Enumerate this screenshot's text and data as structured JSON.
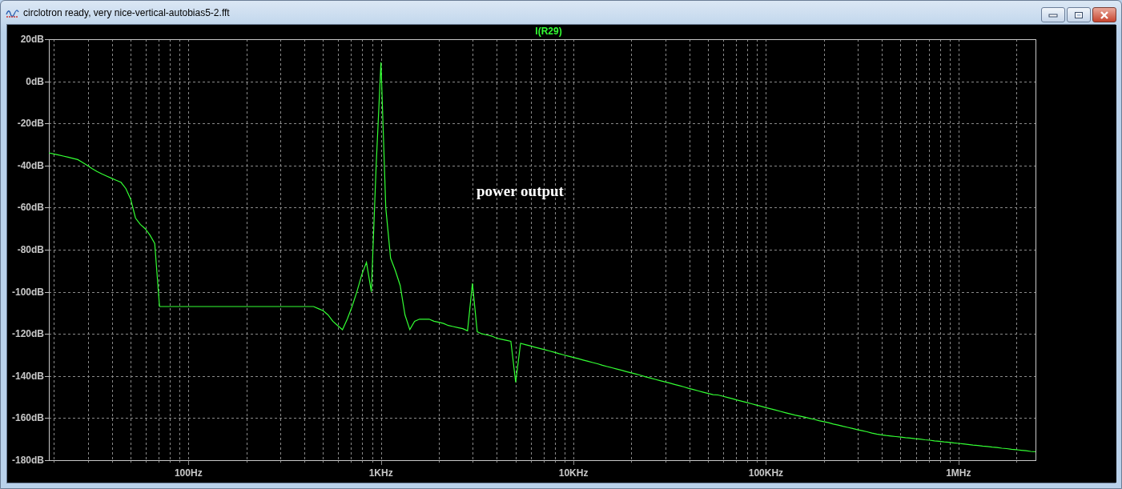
{
  "window": {
    "title": "circlotron ready, very nice-vertical-autobias5-2.fft"
  },
  "plot": {
    "chart_data": {
      "type": "line",
      "grid": true,
      "ylim": [
        -180,
        20
      ],
      "categories": [
        null,
        null,
        null,
        null,
        null,
        null,
        null,
        null,
        null,
        null,
        null,
        null,
        null,
        null,
        null,
        null,
        null,
        null,
        null,
        null,
        null,
        null,
        null,
        null,
        null,
        null,
        null,
        null,
        null,
        "100Hz",
        null,
        null,
        null,
        null,
        null,
        null,
        null,
        null,
        null,
        null,
        null,
        null,
        null,
        null,
        null,
        null,
        null,
        null,
        null,
        null,
        null,
        null,
        null,
        null,
        null,
        null,
        null,
        null,
        null,
        null,
        null,
        null,
        null,
        null,
        null,
        null,
        null,
        null,
        null,
        "1KHz",
        null,
        null,
        null,
        null,
        null,
        null,
        null,
        null,
        null,
        null,
        null,
        null,
        null,
        null,
        null,
        null,
        null,
        null,
        null,
        null,
        null,
        null,
        null,
        null,
        null,
        null,
        null,
        null,
        null,
        null,
        null,
        null,
        null,
        null,
        null,
        null,
        null,
        null,
        null,
        "10KHz",
        null,
        null,
        null,
        null,
        null,
        null,
        null,
        null,
        null,
        null,
        null,
        null,
        null,
        null,
        null,
        null,
        null,
        null,
        null,
        null,
        null,
        null,
        null,
        null,
        null,
        null,
        null,
        null,
        null,
        null,
        null,
        null,
        null,
        null,
        null,
        null,
        null,
        null,
        null,
        "100KHz",
        null,
        null,
        null,
        null,
        null,
        null,
        null,
        null,
        null,
        null,
        null,
        null,
        null,
        null,
        null,
        null,
        null,
        null,
        null,
        null,
        null,
        null,
        null,
        null,
        null,
        null,
        null,
        null,
        null,
        null,
        null,
        null,
        null,
        null,
        null,
        null,
        null,
        null,
        null,
        "1MHz",
        null,
        null,
        null,
        null,
        null,
        null,
        null,
        null,
        null,
        null,
        null,
        null,
        null,
        null,
        null,
        null
      ],
      "yticks": [
        {
          "value": 20,
          "label": "20dB"
        },
        {
          "value": 0,
          "label": "0dB"
        },
        {
          "value": -20,
          "label": "-20dB"
        },
        {
          "value": -40,
          "label": "-40dB"
        },
        {
          "value": -60,
          "label": "-60dB"
        },
        {
          "value": -80,
          "label": "-80dB"
        },
        {
          "value": -100,
          "label": "-100dB"
        },
        {
          "value": -120,
          "label": "-120dB"
        },
        {
          "value": -140,
          "label": "-140dB"
        },
        {
          "value": -160,
          "label": "-160dB"
        },
        {
          "value": -180,
          "label": "-180dB"
        }
      ],
      "series": [
        {
          "name": "I(R29)",
          "color": "#33ff33",
          "values": [
            -34,
            -34.5,
            -35,
            -35.5,
            -36,
            -36.6,
            -37.2,
            -38.5,
            -40,
            -41.5,
            -42.8,
            -44,
            -45,
            -46,
            -47,
            -48,
            -51,
            -56,
            -65,
            -68,
            -70,
            -73,
            -77,
            -107,
            -107,
            -107,
            -107,
            -107,
            -107,
            -107,
            -107,
            -107,
            -107,
            -107,
            -107,
            -107,
            -107,
            -107,
            -107,
            -107,
            -107,
            -107,
            -107,
            -107,
            -107,
            -107,
            -107,
            -107,
            -107,
            -107,
            -107,
            -107,
            -107,
            -107,
            -107,
            -107,
            -108,
            -109,
            -111,
            -114,
            -116,
            -118,
            -113,
            -107,
            -100,
            -92,
            -86,
            -100,
            -40,
            9,
            -60,
            -84,
            -90,
            -97,
            -111,
            -118,
            -114,
            -113,
            -113,
            -113,
            -114,
            -114.5,
            -115,
            -116,
            -116.5,
            -117,
            -117.5,
            -118.5,
            -96,
            -119,
            -120,
            -120.5,
            -121,
            -122,
            -122.5,
            -123,
            -123.5,
            -143,
            -124.5,
            -125.1,
            -125.7,
            -126.3,
            -126.9,
            -127.5,
            -128.1,
            -128.7,
            -129.4,
            -130,
            -130.6,
            -131.2,
            -131.8,
            -132.4,
            -133,
            -133.6,
            -134.2,
            -134.9,
            -135.5,
            -136.1,
            -136.7,
            -137.3,
            -137.9,
            -138.5,
            -139.1,
            -139.7,
            -140.4,
            -141,
            -141.6,
            -142.2,
            -142.8,
            -143.4,
            -144,
            -144.6,
            -145.2,
            -145.9,
            -146.5,
            -147.1,
            -147.7,
            -148.3,
            -148.9,
            -149,
            -149.6,
            -150.2,
            -150.8,
            -151.4,
            -152,
            -152.6,
            -153.2,
            -153.8,
            -154.4,
            -155,
            -155.6,
            -156.2,
            -156.8,
            -157.4,
            -158,
            -158.6,
            -159,
            -159.5,
            -160.1,
            -160.6,
            -161.2,
            -161.7,
            -162.2,
            -162.8,
            -163.3,
            -163.9,
            -164.4,
            -164.9,
            -165.5,
            -166,
            -166.5,
            -167.1,
            -167.6,
            -168,
            -168.3,
            -168.5,
            -168.8,
            -169,
            -169.3,
            -169.5,
            -169.8,
            -170,
            -170.3,
            -170.5,
            -170.8,
            -171,
            -171.3,
            -171.5,
            -171.8,
            -172,
            -172.3,
            -172.5,
            -172.8,
            -173,
            -173.3,
            -173.5,
            -173.8,
            -174,
            -174.3,
            -174.5,
            -174.8,
            -175,
            -175.3,
            -175.5,
            -175.8,
            -176
          ]
        }
      ],
      "annotations": [
        "power output"
      ]
    }
  }
}
